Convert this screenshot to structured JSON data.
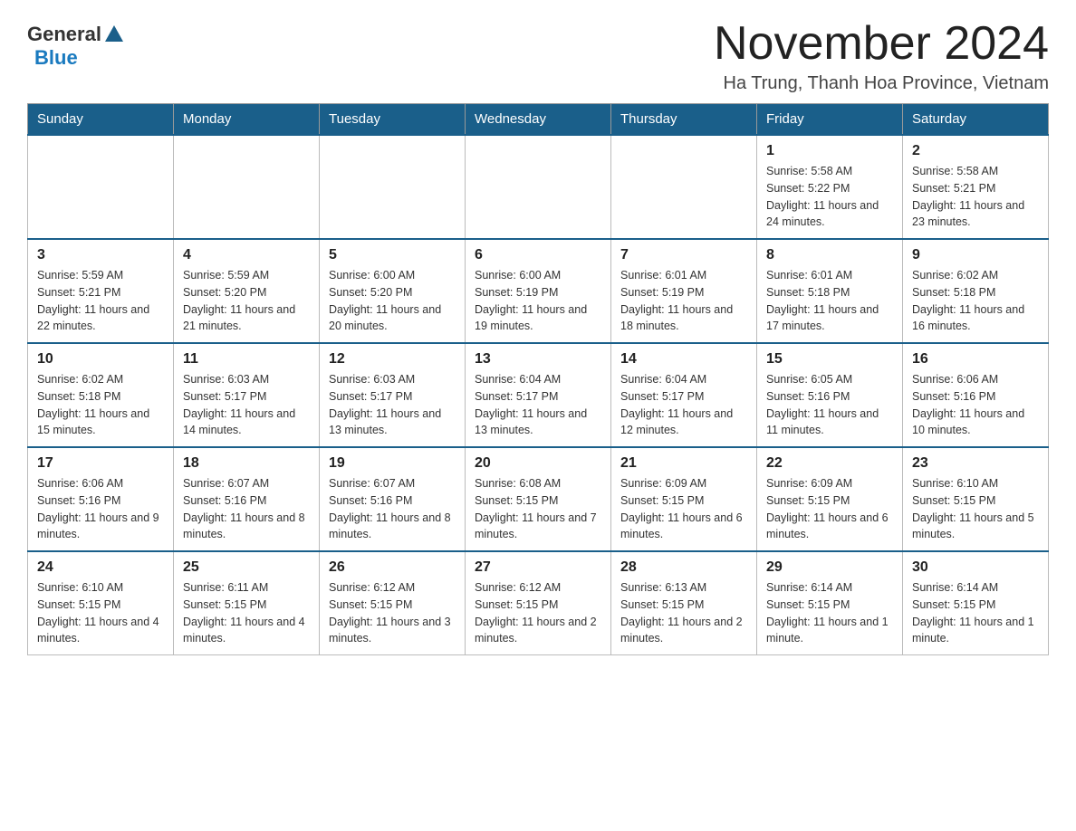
{
  "header": {
    "logo_general": "General",
    "logo_blue": "Blue",
    "month_title": "November 2024",
    "location": "Ha Trung, Thanh Hoa Province, Vietnam"
  },
  "days_of_week": [
    "Sunday",
    "Monday",
    "Tuesday",
    "Wednesday",
    "Thursday",
    "Friday",
    "Saturday"
  ],
  "weeks": [
    [
      {
        "day": "",
        "info": ""
      },
      {
        "day": "",
        "info": ""
      },
      {
        "day": "",
        "info": ""
      },
      {
        "day": "",
        "info": ""
      },
      {
        "day": "",
        "info": ""
      },
      {
        "day": "1",
        "info": "Sunrise: 5:58 AM\nSunset: 5:22 PM\nDaylight: 11 hours and 24 minutes."
      },
      {
        "day": "2",
        "info": "Sunrise: 5:58 AM\nSunset: 5:21 PM\nDaylight: 11 hours and 23 minutes."
      }
    ],
    [
      {
        "day": "3",
        "info": "Sunrise: 5:59 AM\nSunset: 5:21 PM\nDaylight: 11 hours and 22 minutes."
      },
      {
        "day": "4",
        "info": "Sunrise: 5:59 AM\nSunset: 5:20 PM\nDaylight: 11 hours and 21 minutes."
      },
      {
        "day": "5",
        "info": "Sunrise: 6:00 AM\nSunset: 5:20 PM\nDaylight: 11 hours and 20 minutes."
      },
      {
        "day": "6",
        "info": "Sunrise: 6:00 AM\nSunset: 5:19 PM\nDaylight: 11 hours and 19 minutes."
      },
      {
        "day": "7",
        "info": "Sunrise: 6:01 AM\nSunset: 5:19 PM\nDaylight: 11 hours and 18 minutes."
      },
      {
        "day": "8",
        "info": "Sunrise: 6:01 AM\nSunset: 5:18 PM\nDaylight: 11 hours and 17 minutes."
      },
      {
        "day": "9",
        "info": "Sunrise: 6:02 AM\nSunset: 5:18 PM\nDaylight: 11 hours and 16 minutes."
      }
    ],
    [
      {
        "day": "10",
        "info": "Sunrise: 6:02 AM\nSunset: 5:18 PM\nDaylight: 11 hours and 15 minutes."
      },
      {
        "day": "11",
        "info": "Sunrise: 6:03 AM\nSunset: 5:17 PM\nDaylight: 11 hours and 14 minutes."
      },
      {
        "day": "12",
        "info": "Sunrise: 6:03 AM\nSunset: 5:17 PM\nDaylight: 11 hours and 13 minutes."
      },
      {
        "day": "13",
        "info": "Sunrise: 6:04 AM\nSunset: 5:17 PM\nDaylight: 11 hours and 13 minutes."
      },
      {
        "day": "14",
        "info": "Sunrise: 6:04 AM\nSunset: 5:17 PM\nDaylight: 11 hours and 12 minutes."
      },
      {
        "day": "15",
        "info": "Sunrise: 6:05 AM\nSunset: 5:16 PM\nDaylight: 11 hours and 11 minutes."
      },
      {
        "day": "16",
        "info": "Sunrise: 6:06 AM\nSunset: 5:16 PM\nDaylight: 11 hours and 10 minutes."
      }
    ],
    [
      {
        "day": "17",
        "info": "Sunrise: 6:06 AM\nSunset: 5:16 PM\nDaylight: 11 hours and 9 minutes."
      },
      {
        "day": "18",
        "info": "Sunrise: 6:07 AM\nSunset: 5:16 PM\nDaylight: 11 hours and 8 minutes."
      },
      {
        "day": "19",
        "info": "Sunrise: 6:07 AM\nSunset: 5:16 PM\nDaylight: 11 hours and 8 minutes."
      },
      {
        "day": "20",
        "info": "Sunrise: 6:08 AM\nSunset: 5:15 PM\nDaylight: 11 hours and 7 minutes."
      },
      {
        "day": "21",
        "info": "Sunrise: 6:09 AM\nSunset: 5:15 PM\nDaylight: 11 hours and 6 minutes."
      },
      {
        "day": "22",
        "info": "Sunrise: 6:09 AM\nSunset: 5:15 PM\nDaylight: 11 hours and 6 minutes."
      },
      {
        "day": "23",
        "info": "Sunrise: 6:10 AM\nSunset: 5:15 PM\nDaylight: 11 hours and 5 minutes."
      }
    ],
    [
      {
        "day": "24",
        "info": "Sunrise: 6:10 AM\nSunset: 5:15 PM\nDaylight: 11 hours and 4 minutes."
      },
      {
        "day": "25",
        "info": "Sunrise: 6:11 AM\nSunset: 5:15 PM\nDaylight: 11 hours and 4 minutes."
      },
      {
        "day": "26",
        "info": "Sunrise: 6:12 AM\nSunset: 5:15 PM\nDaylight: 11 hours and 3 minutes."
      },
      {
        "day": "27",
        "info": "Sunrise: 6:12 AM\nSunset: 5:15 PM\nDaylight: 11 hours and 2 minutes."
      },
      {
        "day": "28",
        "info": "Sunrise: 6:13 AM\nSunset: 5:15 PM\nDaylight: 11 hours and 2 minutes."
      },
      {
        "day": "29",
        "info": "Sunrise: 6:14 AM\nSunset: 5:15 PM\nDaylight: 11 hours and 1 minute."
      },
      {
        "day": "30",
        "info": "Sunrise: 6:14 AM\nSunset: 5:15 PM\nDaylight: 11 hours and 1 minute."
      }
    ]
  ]
}
